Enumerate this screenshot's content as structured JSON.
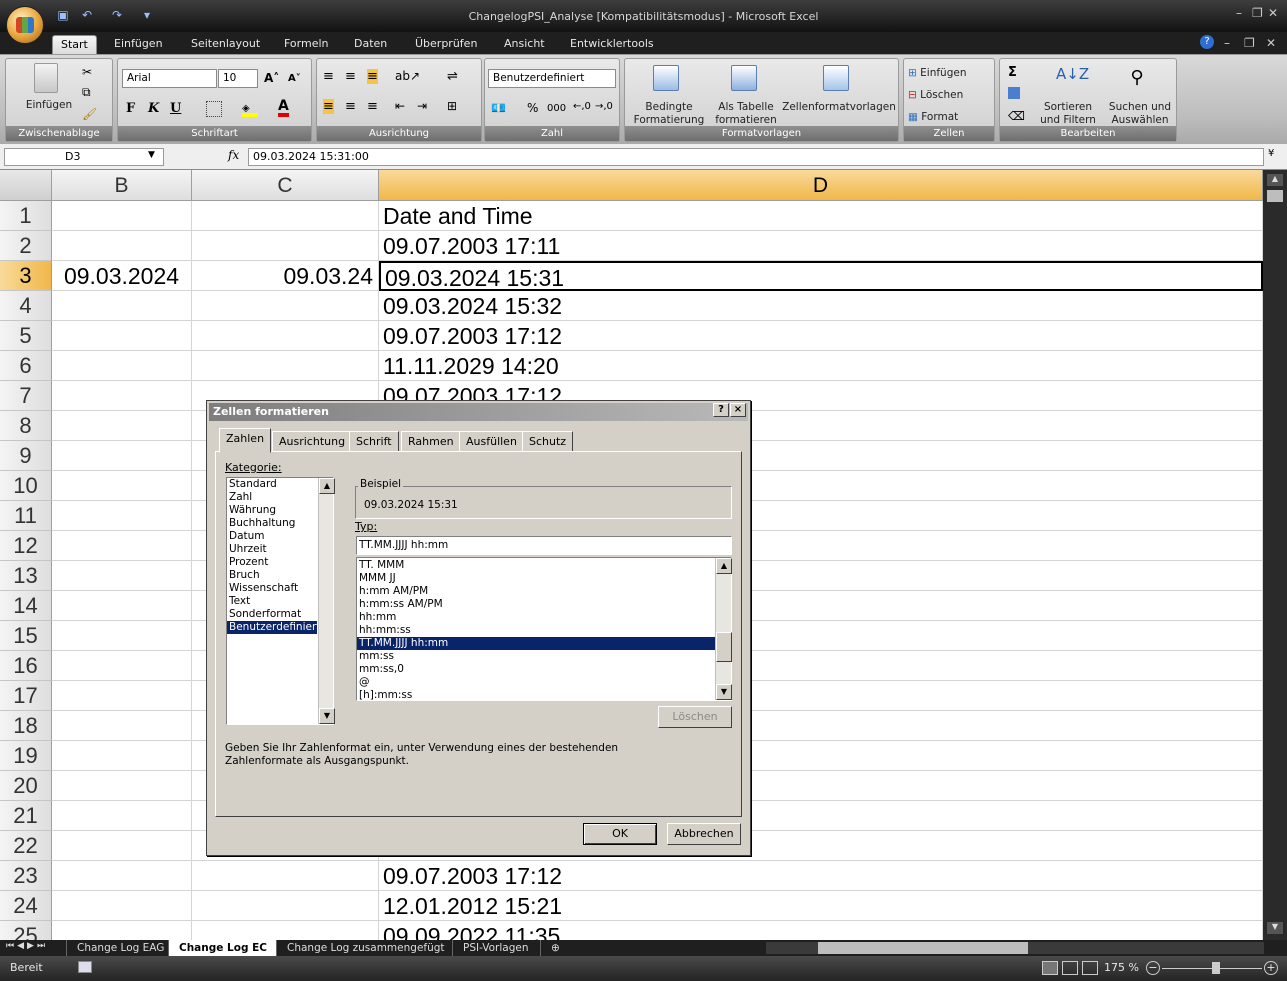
{
  "app": {
    "window_title": "ChangelogPSI_Analyse  [Kompatibilitätsmodus] - Microsoft Excel"
  },
  "ribbon_tabs": [
    "Start",
    "Einfügen",
    "Seitenlayout",
    "Formeln",
    "Daten",
    "Überprüfen",
    "Ansicht",
    "Entwicklertools"
  ],
  "ribbon": {
    "clipboard": {
      "paste": "Einfügen",
      "label": "Zwischenablage"
    },
    "font": {
      "name": "Arial",
      "size": "10",
      "bold": "F",
      "italic": "K",
      "underline": "U",
      "label": "Schriftart"
    },
    "alignment": {
      "label": "Ausrichtung"
    },
    "number": {
      "format": "Benutzerdefiniert",
      "percent": "%",
      "thousands": "000",
      "label": "Zahl"
    },
    "styles": {
      "cond_line1": "Bedingte",
      "cond_line2": "Formatierung",
      "table_line1": "Als Tabelle",
      "table_line2": "formatieren",
      "cellstyles": "Zellenformatvorlagen",
      "label": "Formatvorlagen"
    },
    "cells": {
      "insert": "Einfügen",
      "delete": "Löschen",
      "format": "Format",
      "label": "Zellen"
    },
    "editing": {
      "sum": "Σ",
      "sort_line1": "Sortieren",
      "sort_line2": "und Filtern",
      "find_line1": "Suchen und",
      "find_line2": "Auswählen",
      "label": "Bearbeiten"
    }
  },
  "formula_bar": {
    "name_box": "D3",
    "fx": "fx",
    "value": "09.03.2024 15:31:00"
  },
  "columns": [
    "B",
    "C",
    "D"
  ],
  "rows": [
    {
      "n": "1",
      "b": "",
      "c": "",
      "d": "Date and Time"
    },
    {
      "n": "2",
      "b": "",
      "c": "",
      "d": "09.07.2003 17:11"
    },
    {
      "n": "3",
      "b": "09.03.2024",
      "c": "09.03.24",
      "d": "09.03.2024 15:31"
    },
    {
      "n": "4",
      "b": "",
      "c": "",
      "d": "09.03.2024 15:32"
    },
    {
      "n": "5",
      "b": "",
      "c": "",
      "d": "09.07.2003 17:12"
    },
    {
      "n": "6",
      "b": "",
      "c": "",
      "d": "11.11.2029 14:20"
    },
    {
      "n": "7",
      "b": "",
      "c": "",
      "d": "09.07.2003 17:12"
    },
    {
      "n": "8",
      "b": "",
      "c": "",
      "d": ""
    },
    {
      "n": "9",
      "b": "",
      "c": "",
      "d": ""
    },
    {
      "n": "10",
      "b": "",
      "c": "",
      "d": ""
    },
    {
      "n": "11",
      "b": "",
      "c": "",
      "d": ""
    },
    {
      "n": "12",
      "b": "",
      "c": "",
      "d": ""
    },
    {
      "n": "13",
      "b": "",
      "c": "",
      "d": ""
    },
    {
      "n": "14",
      "b": "",
      "c": "",
      "d": ""
    },
    {
      "n": "15",
      "b": "",
      "c": "",
      "d": ""
    },
    {
      "n": "16",
      "b": "",
      "c": "",
      "d": ""
    },
    {
      "n": "17",
      "b": "",
      "c": "",
      "d": ""
    },
    {
      "n": "18",
      "b": "",
      "c": "",
      "d": ""
    },
    {
      "n": "19",
      "b": "",
      "c": "",
      "d": ""
    },
    {
      "n": "20",
      "b": "",
      "c": "",
      "d": ""
    },
    {
      "n": "21",
      "b": "",
      "c": "",
      "d": ""
    },
    {
      "n": "22",
      "b": "",
      "c": "",
      "d": ""
    },
    {
      "n": "23",
      "b": "",
      "c": "",
      "d": "09.07.2003 17:12"
    },
    {
      "n": "24",
      "b": "",
      "c": "",
      "d": "12.01.2012 15:21"
    },
    {
      "n": "25",
      "b": "",
      "c": "",
      "d": "09.09.2022 11:35"
    }
  ],
  "sheet_tabs": [
    "Change Log EAG",
    "Change Log EC",
    "Change Log zusammengefügt",
    "PSI-Vorlagen"
  ],
  "status": {
    "ready": "Bereit",
    "zoom": "175 %"
  },
  "dialog": {
    "title": "Zellen formatieren",
    "help": "?",
    "close": "×",
    "tabs": [
      "Zahlen",
      "Ausrichtung",
      "Schrift",
      "Rahmen",
      "Ausfüllen",
      "Schutz"
    ],
    "category_label": "Kategorie:",
    "categories": [
      "Standard",
      "Zahl",
      "Währung",
      "Buchhaltung",
      "Datum",
      "Uhrzeit",
      "Prozent",
      "Bruch",
      "Wissenschaft",
      "Text",
      "Sonderformat",
      "Benutzerdefiniert"
    ],
    "sample_label": "Beispiel",
    "sample_value": "09.03.2024 15:31",
    "type_label": "Typ:",
    "type_value": "TT.MM.JJJJ hh:mm",
    "type_list": [
      "TT. MMM",
      "MMM JJ",
      "h:mm AM/PM",
      "h:mm:ss AM/PM",
      "hh:mm",
      "hh:mm:ss",
      "TT.MM.JJJJ hh:mm",
      "mm:ss",
      "mm:ss,0",
      "@",
      "[h]:mm:ss"
    ],
    "delete": "Löschen",
    "hint": "Geben Sie Ihr Zahlenformat ein, unter Verwendung eines der bestehenden Zahlenformate als Ausgangspunkt.",
    "ok": "OK",
    "cancel": "Abbrechen"
  }
}
